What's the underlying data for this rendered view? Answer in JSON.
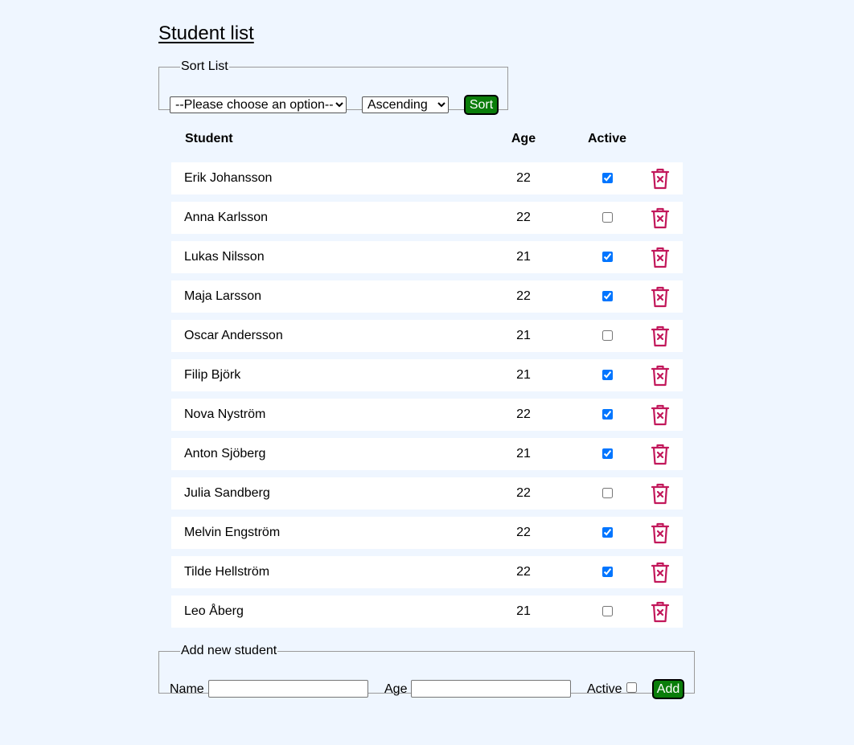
{
  "page": {
    "title": "Student list"
  },
  "sort": {
    "legend": "Sort List",
    "field_selected": "--Please choose an option--",
    "order_selected": "Ascending",
    "button_label": "Sort"
  },
  "table": {
    "headers": {
      "student": "Student",
      "age": "Age",
      "active": "Active"
    },
    "rows": [
      {
        "name": "Erik Johansson",
        "age": "22",
        "active": true
      },
      {
        "name": "Anna Karlsson",
        "age": "22",
        "active": false
      },
      {
        "name": "Lukas Nilsson",
        "age": "21",
        "active": true
      },
      {
        "name": "Maja Larsson",
        "age": "22",
        "active": true
      },
      {
        "name": "Oscar Andersson",
        "age": "21",
        "active": false
      },
      {
        "name": "Filip Björk",
        "age": "21",
        "active": true
      },
      {
        "name": "Nova Nyström",
        "age": "22",
        "active": true
      },
      {
        "name": "Anton Sjöberg",
        "age": "21",
        "active": true
      },
      {
        "name": "Julia Sandberg",
        "age": "22",
        "active": false
      },
      {
        "name": "Melvin Engström",
        "age": "22",
        "active": true
      },
      {
        "name": "Tilde Hellström",
        "age": "22",
        "active": true
      },
      {
        "name": "Leo Åberg",
        "age": "21",
        "active": false
      }
    ],
    "delete_icon": "trash-x-icon"
  },
  "add_student": {
    "legend": "Add new student",
    "name_label": "Name",
    "name_value": "",
    "age_label": "Age",
    "age_value": "",
    "active_label": "Active",
    "active_checked": false,
    "button_label": "Add"
  },
  "colors": {
    "background": "#eff6ff",
    "button_green": "#0a7d0a",
    "delete_icon": "#c2185b",
    "checkbox_accent": "#0075ff"
  }
}
